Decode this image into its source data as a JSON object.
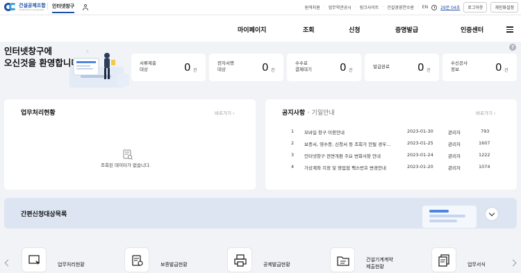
{
  "topbar": {
    "logo_name": "건설공제조합",
    "logo_sub": "Construction Guarantee",
    "site_tab": "인터넷창구",
    "links": [
      "원격지원",
      "업무약관공시",
      "링크사이트",
      "건설경영연수원",
      "EN"
    ],
    "timer": "29분 04초",
    "logout": "로그아웃",
    "settings": "개인화설정"
  },
  "gnb": {
    "items": [
      "마이페이지",
      "조회",
      "신청",
      "증명발급",
      "인증센터"
    ]
  },
  "welcome": {
    "line1": "인터넷창구에",
    "line2": "오신것을 환영합니다"
  },
  "stats": [
    {
      "label1": "서류제출",
      "label2": "대상",
      "value": "0",
      "unit": "건"
    },
    {
      "label1": "전자서명",
      "label2": "대상",
      "value": "0",
      "unit": "건"
    },
    {
      "label1": "수수료",
      "label2": "결제대기",
      "value": "0",
      "unit": "건"
    },
    {
      "label1": "발급완료",
      "label2": "",
      "value": "0",
      "unit": "건"
    },
    {
      "label1": "수신공사",
      "label2": "정보",
      "value": "0",
      "unit": "건"
    }
  ],
  "work_panel": {
    "title": "업무처리현황",
    "more": "바로가기",
    "empty": "조회된 데이터가 없습니다."
  },
  "notice_panel": {
    "tab_active": "공지사항",
    "tab_inactive": "기일안내",
    "more": "바로가기",
    "rows": [
      {
        "no": "1",
        "title": "모바일 창구 이용안내",
        "date": "2023-01-30",
        "author": "관리자",
        "views": "793"
      },
      {
        "no": "2",
        "title": "보증서, 영수증, 신청서 등 조회가 안될 경우...",
        "date": "2023-01-25",
        "author": "관리자",
        "views": "1607"
      },
      {
        "no": "3",
        "title": "인터넷창구 전면개편 주요 변화사항 안내",
        "date": "2023-01-24",
        "author": "관리자",
        "views": "1222"
      },
      {
        "no": "4",
        "title": "가상계좌 지정 및 영업점 팩스번호 변경안내",
        "date": "2023-01-20",
        "author": "관리자",
        "views": "1074"
      }
    ]
  },
  "quick": {
    "title": "간편신청대상목록"
  },
  "services": [
    {
      "label": "업무처리현황",
      "label2": ""
    },
    {
      "label": "보증발급현황",
      "label2": ""
    },
    {
      "label": "공제발급현황",
      "label2": ""
    },
    {
      "label": "건설기계계약",
      "label2": "제출현황"
    },
    {
      "label": "업무서식",
      "label2": ""
    }
  ]
}
